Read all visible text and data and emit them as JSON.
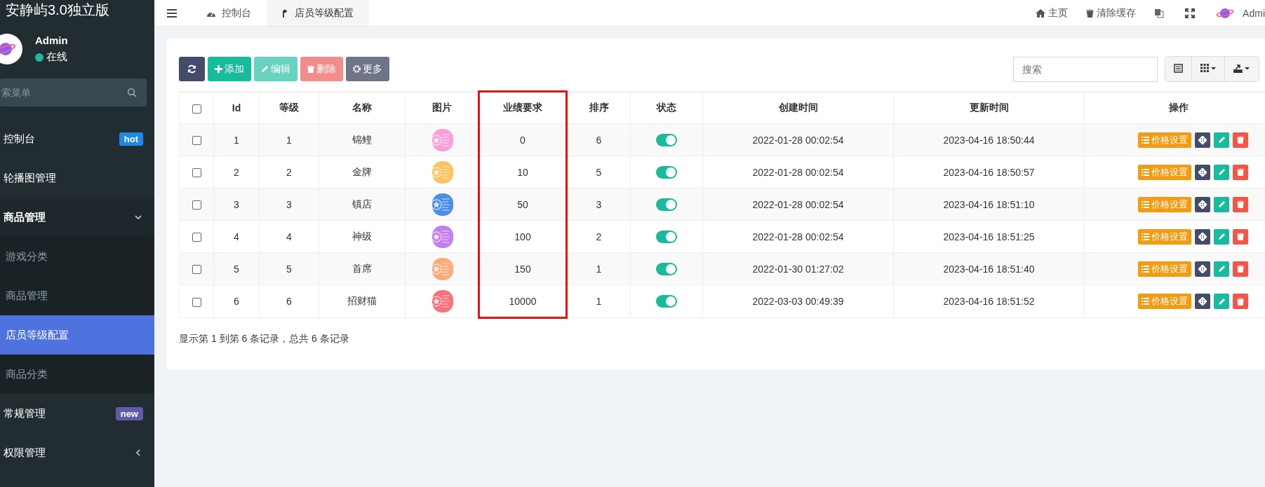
{
  "sidebar": {
    "title": "安静屿3.0独立版",
    "user": {
      "name": "Admin",
      "status": "在线",
      "online": true
    },
    "search": {
      "placeholder": "索菜单"
    },
    "menu": [
      {
        "label": "控制台",
        "badge": {
          "text": "hot",
          "color": "#1e88e5"
        },
        "selected": false
      },
      {
        "label": "轮播图管理",
        "selected": false
      },
      {
        "label": "商品管理",
        "expanded": true,
        "selected": false,
        "children": [
          {
            "label": "游戏分类",
            "selected": false
          },
          {
            "label": "商品管理",
            "selected": false
          },
          {
            "label": "店员等级配置",
            "selected": true
          },
          {
            "label": "商品分类",
            "selected": false
          }
        ]
      },
      {
        "label": "常规管理",
        "badge": {
          "text": "new",
          "color": "#605ca8"
        },
        "selected": false
      },
      {
        "label": "权限管理",
        "expanded": false,
        "selected": false
      }
    ]
  },
  "topbar": {
    "tabs": [
      {
        "label": "控制台",
        "selected": false
      },
      {
        "label": "店员等级配置",
        "selected": true
      }
    ],
    "links": [
      "主页",
      "清除缓存"
    ],
    "user": "Admi"
  },
  "toolbar": {
    "buttons": [
      {
        "kind": "refresh",
        "disabled": false
      },
      {
        "kind": "add",
        "label": "添加",
        "disabled": false
      },
      {
        "kind": "edit",
        "label": "编辑",
        "disabled": true
      },
      {
        "kind": "delete",
        "label": "删除",
        "disabled": true
      },
      {
        "kind": "more",
        "label": "更多",
        "disabled": false
      }
    ],
    "search": {
      "placeholder": "搜索"
    }
  },
  "table": {
    "header_checked": false,
    "columns": [
      {
        "label": "Id",
        "highlighted": false
      },
      {
        "label": "等级",
        "highlighted": false
      },
      {
        "label": "名称",
        "highlighted": false
      },
      {
        "label": "图片",
        "highlighted": false
      },
      {
        "label": "业绩要求",
        "highlighted": true
      },
      {
        "label": "排序",
        "highlighted": false
      },
      {
        "label": "状态",
        "highlighted": false
      },
      {
        "label": "创建时间",
        "highlighted": false
      },
      {
        "label": "更新时间",
        "highlighted": false
      },
      {
        "label": "操作",
        "highlighted": false
      }
    ],
    "rows": [
      {
        "checked": false,
        "id": "1",
        "level": "1",
        "name": "锦鲤",
        "color": "#f7a1d8",
        "requirement": "0",
        "order": "6",
        "on": true,
        "created": "2022-01-28 00:02:54",
        "updated": "2023-04-16 18:50:44",
        "action": "价格设置"
      },
      {
        "checked": false,
        "id": "2",
        "level": "2",
        "name": "金牌",
        "color": "#fbc25e",
        "requirement": "10",
        "order": "5",
        "on": true,
        "created": "2022-01-28 00:02:54",
        "updated": "2023-04-16 18:50:57",
        "action": "价格设置"
      },
      {
        "checked": false,
        "id": "3",
        "level": "3",
        "name": "镇店",
        "color": "#4a90e8",
        "requirement": "50",
        "order": "3",
        "on": true,
        "created": "2022-01-28 00:02:54",
        "updated": "2023-04-16 18:51:10",
        "action": "价格设置"
      },
      {
        "checked": false,
        "id": "4",
        "level": "4",
        "name": "神级",
        "color": "#c27ef0",
        "requirement": "100",
        "order": "2",
        "on": true,
        "created": "2022-01-28 00:02:54",
        "updated": "2023-04-16 18:51:25",
        "action": "价格设置"
      },
      {
        "checked": false,
        "id": "5",
        "level": "5",
        "name": "首席",
        "color": "#fbaa78",
        "requirement": "150",
        "order": "1",
        "on": true,
        "created": "2022-01-30 01:27:02",
        "updated": "2023-04-16 18:51:40",
        "action": "价格设置"
      },
      {
        "checked": false,
        "id": "6",
        "level": "6",
        "name": "招财猫",
        "color": "#f7707a",
        "requirement": "10000",
        "order": "1",
        "on": true,
        "created": "2022-03-03 00:49:39",
        "updated": "2023-04-16 18:51:52",
        "action": "价格设置"
      }
    ],
    "footer": "显示第 1 到第 6 条记录，总共 6 条记录"
  }
}
